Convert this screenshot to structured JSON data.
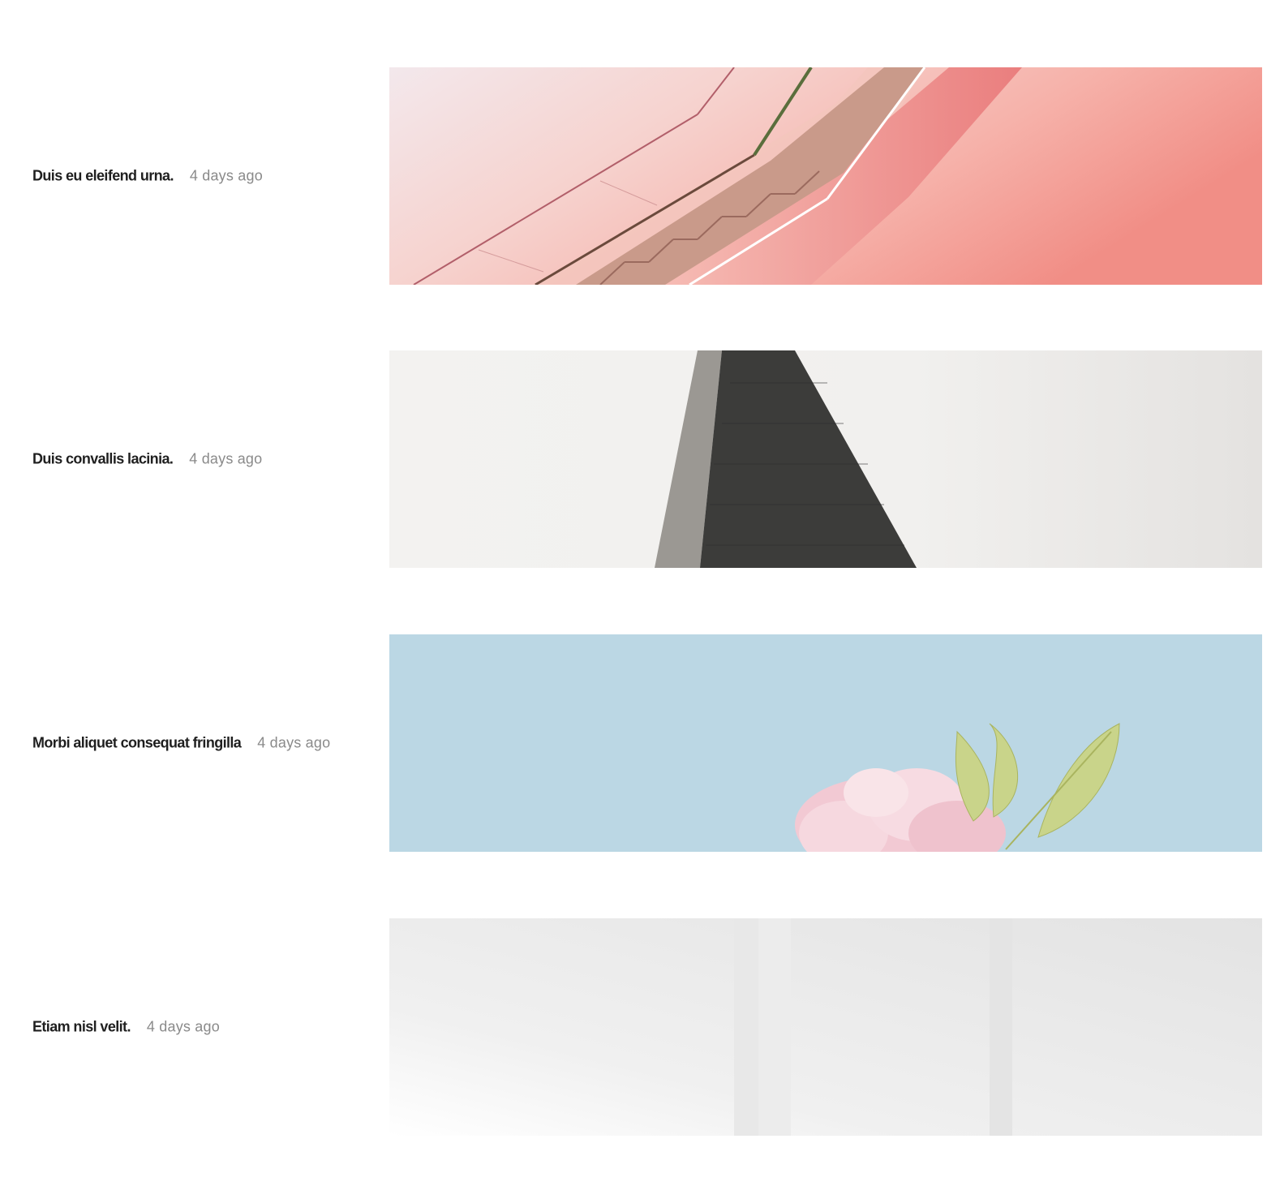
{
  "posts": [
    {
      "title": "Duis eu eleifend urna.",
      "date": "4 days ago",
      "image": "pink-staircase-photo"
    },
    {
      "title": "Duis convallis lacinia.",
      "date": "4 days ago",
      "image": "dark-spire-photo"
    },
    {
      "title": "Morbi aliquet consequat fringilla",
      "date": "4 days ago",
      "image": "pink-flower-on-blue-photo"
    },
    {
      "title": "Etiam nisl velit.",
      "date": "4 days ago",
      "image": "white-interior-photo"
    }
  ],
  "colors": {
    "title": "#1f1f1f",
    "date": "#8a8a8a",
    "sky_blue": "#bbd7e4",
    "coral": "#f08a85"
  }
}
